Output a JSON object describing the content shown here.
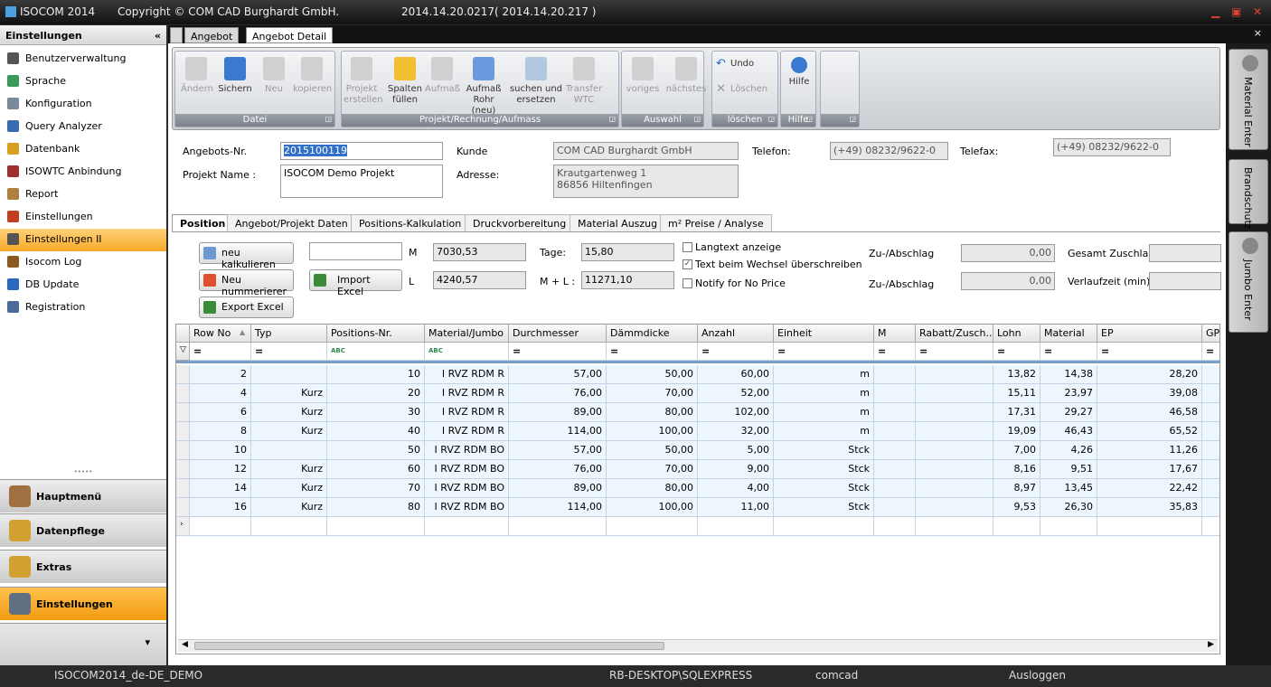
{
  "titlebar": {
    "app": "ISOCOM 2014",
    "copyright": "Copyright © COM CAD Burghardt GmbH.",
    "version": "2014.14.20.0217( 2014.14.20.217 )"
  },
  "sidebar": {
    "title": "Einstellungen",
    "collapse": "«",
    "items": [
      {
        "label": "Benutzerverwaltung",
        "color": "#555"
      },
      {
        "label": "Sprache",
        "color": "#3a9a5a"
      },
      {
        "label": "Konfiguration",
        "color": "#7a8a9a"
      },
      {
        "label": "Query Analyzer",
        "color": "#3a6ab0"
      },
      {
        "label": "Datenbank",
        "color": "#d9a020"
      },
      {
        "label": "ISOWTC Anbindung",
        "color": "#a03030"
      },
      {
        "label": "Report",
        "color": "#b08040"
      },
      {
        "label": "Einstellungen",
        "color": "#c04020"
      },
      {
        "label": "Einstellungen II",
        "color": "#555",
        "selected": true
      },
      {
        "label": "Isocom Log",
        "color": "#8a5a20"
      },
      {
        "label": "DB Update",
        "color": "#2a6ac0"
      },
      {
        "label": "Registration",
        "color": "#4a6a9a"
      }
    ],
    "nav": [
      {
        "label": "Hauptmenü",
        "color": "#a07040"
      },
      {
        "label": "Datenpflege",
        "color": "#d0a030"
      },
      {
        "label": "Extras",
        "color": "#d0a030"
      },
      {
        "label": "Einstellungen",
        "color": "#607080",
        "selected": true
      }
    ],
    "more": "▾"
  },
  "doc_tabs": [
    "Angebot",
    "Angebot Detail"
  ],
  "close": "×",
  "toolbar": {
    "groups": [
      {
        "label": "Datei",
        "buttons": [
          {
            "label": "Ändern",
            "enabled": false
          },
          {
            "label": "Sichern",
            "enabled": true,
            "color": "#3a7ad0"
          },
          {
            "label": "Neu",
            "enabled": false
          },
          {
            "label": "kopieren",
            "enabled": false
          }
        ]
      },
      {
        "label": "Projekt/Rechnung/Aufmass",
        "buttons": [
          {
            "label": "Projekt erstellen",
            "enabled": false
          },
          {
            "label": "Spalten füllen",
            "enabled": true,
            "color": "#f0c030"
          },
          {
            "label": "Aufmaß",
            "enabled": false
          },
          {
            "label": "Aufmaß Rohr (neu)",
            "enabled": true,
            "color": "#6a9ae0"
          },
          {
            "label": "suchen und ersetzen",
            "enabled": true,
            "color": "#b0c8e0"
          },
          {
            "label": "Transfer WTC",
            "enabled": false
          }
        ]
      },
      {
        "label": "Auswahl",
        "buttons": [
          {
            "label": "voriges",
            "enabled": false
          },
          {
            "label": "nächstes",
            "enabled": false
          }
        ]
      },
      {
        "label": "löschen",
        "buttons": [
          {
            "label": "Undo",
            "enabled": true
          },
          {
            "label": "Löschen",
            "enabled": false
          }
        ]
      },
      {
        "label": "Hilfe",
        "buttons": [
          {
            "label": "Hilfe",
            "enabled": true
          }
        ]
      },
      {
        "label": "",
        "buttons": []
      }
    ]
  },
  "form": {
    "angebot_nr_label": "Angebots-Nr.",
    "angebot_nr": "2015100119",
    "projekt_label": "Projekt Name :",
    "projekt": "ISOCOM Demo Projekt",
    "kunde_label": "Kunde",
    "kunde": "COM CAD Burghardt GmbH",
    "adresse_label": "Adresse:",
    "adresse1": "Krautgartenweg 1",
    "adresse2": "86856 Hiltenfingen",
    "telefon_label": "Telefon:",
    "telefon": "(+49) 08232/9622-0",
    "telefax_label": "Telefax:",
    "telefax": "(+49) 08232/9622-0"
  },
  "subtabs": [
    "Position",
    "Angebot/Projekt Daten",
    "Positions-Kalkulation",
    "Druckvorbereitung",
    "Material Auszug",
    "m² Preise / Analyse"
  ],
  "controls": {
    "neu_kalkulieren": "neu kalkulieren",
    "neu_nummerieren": "Neu nummerierer",
    "export_excel": "Export Excel",
    "import_excel": "Import Excel",
    "input_value": "",
    "m_label": "M",
    "m_value": "7030,53",
    "l_label": "L",
    "l_value": "4240,57",
    "tage_label": "Tage:",
    "tage": "15,80",
    "ml_label": "M + L :",
    "ml": "11271,10",
    "langtext": {
      "label": "Langtext anzeige",
      "checked": false
    },
    "text_wechsel": {
      "label": "Text beim Wechsel überschreiben",
      "checked": true
    },
    "notify": {
      "label": "Notify for No Price",
      "checked": false
    },
    "zu_abschlag1_label": "Zu-/Abschlag",
    "zu_abschlag1": "0,00",
    "zu_abschlag2_label": "Zu-/Abschlag",
    "zu_abschlag2": "0,00",
    "gesamt_zuschlag_label": "Gesamt Zuschlag",
    "verlaufzeit_label": "Verlaufzeit (min)"
  },
  "grid": {
    "columns": [
      "Row No",
      "Typ",
      "Positions-Nr.",
      "Material/Jumbo",
      "Durchmesser",
      "Dämmdicke",
      "Anzahl",
      "Einheit",
      "M",
      "Rabatt/Zusch...",
      "Lohn",
      "Material",
      "EP",
      "GP"
    ],
    "filters": [
      "=",
      "=",
      "ABC",
      "ABC",
      "=",
      "=",
      "=",
      "=",
      "=",
      "=",
      "=",
      "=",
      "=",
      "="
    ],
    "rows": [
      [
        "2",
        "",
        "10",
        "I RVZ RDM R",
        "57,00",
        "50,00",
        "60,00",
        "m",
        "",
        "",
        "13,82",
        "14,38",
        "28,20",
        ""
      ],
      [
        "4",
        "Kurz",
        "20",
        "I RVZ RDM R",
        "76,00",
        "70,00",
        "52,00",
        "m",
        "",
        "",
        "15,11",
        "23,97",
        "39,08",
        ""
      ],
      [
        "6",
        "Kurz",
        "30",
        "I RVZ RDM R",
        "89,00",
        "80,00",
        "102,00",
        "m",
        "",
        "",
        "17,31",
        "29,27",
        "46,58",
        ""
      ],
      [
        "8",
        "Kurz",
        "40",
        "I RVZ RDM R",
        "114,00",
        "100,00",
        "32,00",
        "m",
        "",
        "",
        "19,09",
        "46,43",
        "65,52",
        ""
      ],
      [
        "10",
        "",
        "50",
        "I RVZ RDM BO",
        "57,00",
        "50,00",
        "5,00",
        "Stck",
        "",
        "",
        "7,00",
        "4,26",
        "11,26",
        ""
      ],
      [
        "12",
        "Kurz",
        "60",
        "I RVZ RDM BO",
        "76,00",
        "70,00",
        "9,00",
        "Stck",
        "",
        "",
        "8,16",
        "9,51",
        "17,67",
        ""
      ],
      [
        "14",
        "Kurz",
        "70",
        "I RVZ RDM BO",
        "89,00",
        "80,00",
        "4,00",
        "Stck",
        "",
        "",
        "8,97",
        "13,45",
        "22,42",
        ""
      ],
      [
        "16",
        "Kurz",
        "80",
        "I RVZ RDM BO",
        "114,00",
        "100,00",
        "11,00",
        "Stck",
        "",
        "",
        "9,53",
        "26,30",
        "35,83",
        ""
      ]
    ]
  },
  "right_tabs": [
    "Material Enter",
    "Brandschutz",
    "Jumbo Enter"
  ],
  "status": {
    "locale": "ISOCOM2014_de-DE_DEMO",
    "server": "RB-DESKTOP\\SQLEXPRESS",
    "user": "comcad",
    "logout": "Ausloggen"
  }
}
